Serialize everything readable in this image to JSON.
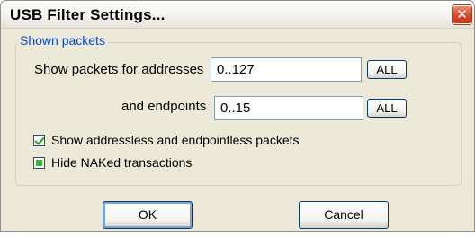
{
  "window": {
    "title": "USB Filter Settings...",
    "close_glyph": "✕"
  },
  "group": {
    "label": "Shown packets"
  },
  "addresses": {
    "label": "Show packets for addresses",
    "value": "0..127",
    "all_button": "ALL"
  },
  "endpoints": {
    "label": "and endpoints",
    "value": "0..15",
    "all_button": "ALL"
  },
  "options": {
    "addressless": {
      "label": "Show addressless and endpointless packets",
      "state": "checked"
    },
    "naked": {
      "label": "Hide NAKed transactions",
      "state": "indeterminate"
    }
  },
  "buttons": {
    "ok": "OK",
    "cancel": "Cancel"
  },
  "icons": {
    "close": "close-icon",
    "check": "checkmark-icon"
  },
  "colors": {
    "dialog_bg": "#ece9d8",
    "group_label": "#0046d5",
    "close_button": "#d8482a",
    "check_green": "#21a121"
  }
}
